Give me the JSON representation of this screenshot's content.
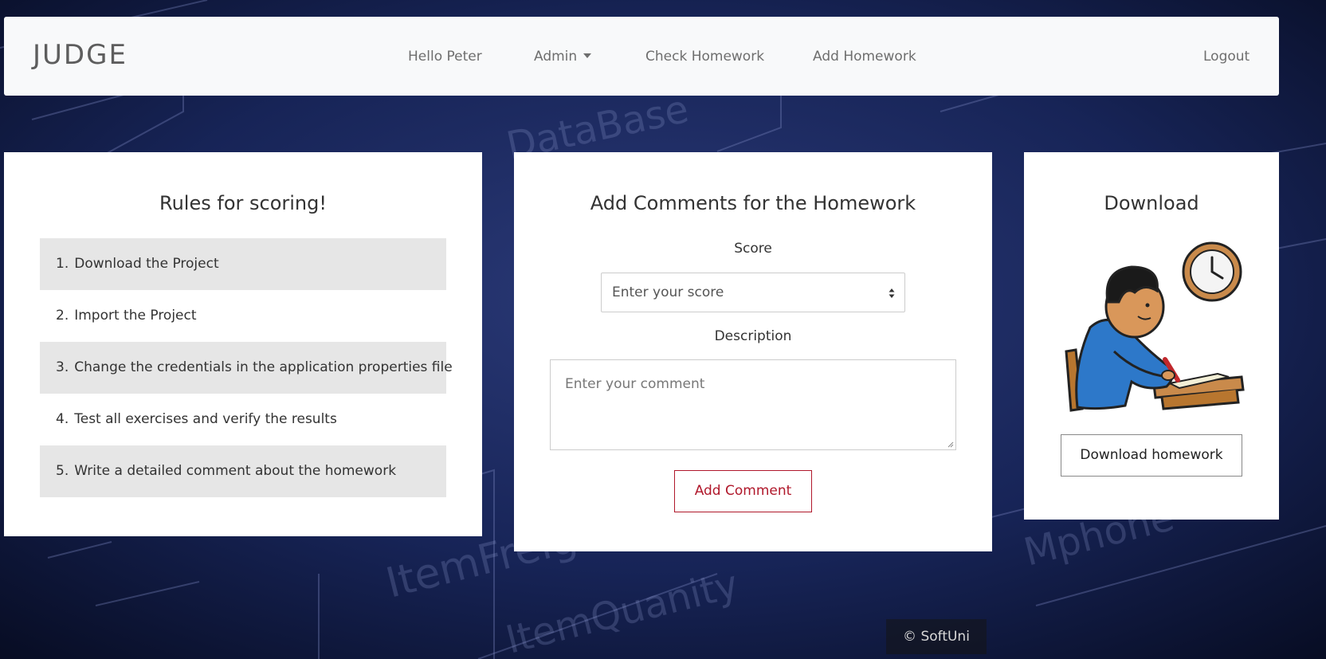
{
  "navbar": {
    "brand": "JUDGE",
    "greeting": "Hello Peter",
    "admin": "Admin",
    "check_homework": "Check Homework",
    "add_homework": "Add Homework",
    "logout": "Logout"
  },
  "rules_card": {
    "title": "Rules for scoring!",
    "items": [
      {
        "num": "1.",
        "text": "Download the Project"
      },
      {
        "num": "2.",
        "text": "Import the Project"
      },
      {
        "num": "3.",
        "text": "Change the credentials in the application properties file"
      },
      {
        "num": "4.",
        "text": "Test all exercises and verify the results"
      },
      {
        "num": "5.",
        "text": "Write a detailed comment about the homework"
      }
    ]
  },
  "comment_card": {
    "title": "Add Comments for the Homework",
    "score_label": "Score",
    "score_placeholder": "Enter your score",
    "description_label": "Description",
    "comment_placeholder": "Enter your comment",
    "submit_label": "Add Comment"
  },
  "download_card": {
    "title": "Download",
    "button_label": "Download homework"
  },
  "footer": {
    "text": "© SoftUni"
  },
  "colors": {
    "navbar_bg": "#f8f9fa",
    "accent_red": "#b0182b",
    "shaded_row": "#e6e6e6",
    "background": "#101a3a"
  }
}
